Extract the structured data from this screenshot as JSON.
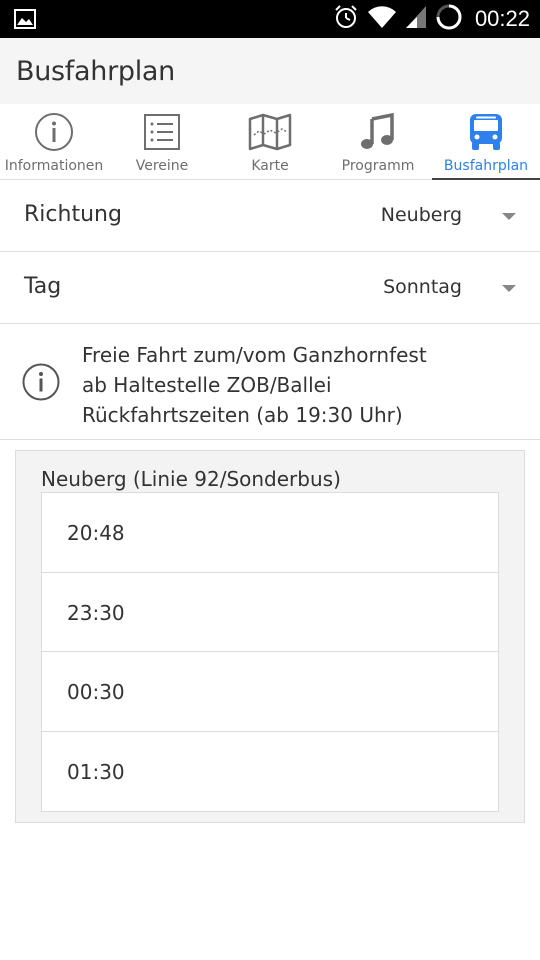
{
  "statusbar": {
    "time": "00:22",
    "icons": [
      "image-icon",
      "alarm-icon",
      "wifi-icon",
      "signal-icon",
      "battery-icon"
    ]
  },
  "appbar": {
    "title": "Busfahrplan"
  },
  "tabs": [
    {
      "label": "Informationen",
      "icon": "info-icon",
      "active": false
    },
    {
      "label": "Vereine",
      "icon": "list-icon",
      "active": false
    },
    {
      "label": "Karte",
      "icon": "map-icon",
      "active": false
    },
    {
      "label": "Programm",
      "icon": "music-icon",
      "active": false
    },
    {
      "label": "Busfahrplan",
      "icon": "bus-icon",
      "active": true
    }
  ],
  "colors": {
    "accent": "#2f80ed",
    "icon_gray": "#6e6e6e",
    "divider": "#dddddd",
    "card_bg": "#f3f3f3"
  },
  "filters": {
    "direction": {
      "label": "Richtung",
      "value": "Neuberg"
    },
    "day": {
      "label": "Tag",
      "value": "Sonntag"
    }
  },
  "info": {
    "lines": [
      "Freie Fahrt zum/vom Ganzhornfest",
      "ab Haltestelle ZOB/Ballei",
      "Rückfahrtszeiten (ab 19:30 Uhr)"
    ]
  },
  "schedule": {
    "title": "Neuberg (Linie 92/Sonderbus)",
    "times": [
      "20:48",
      "23:30",
      "00:30",
      "01:30"
    ]
  }
}
